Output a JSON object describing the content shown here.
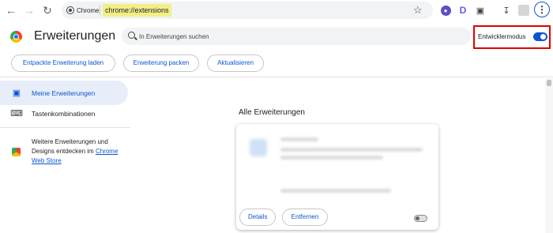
{
  "browser": {
    "back_icon": "arrow-left-icon",
    "forward_icon": "arrow-right-icon",
    "reload_icon": "reload-icon",
    "site_chip_label": "Chrome",
    "url": "chrome://extensions",
    "accent_color": "#0b57d0",
    "highlight_color": "#f2ef8a"
  },
  "header": {
    "title": "Erweiterungen",
    "search_placeholder": "In Erweiterungen suchen",
    "dev_mode_label": "Entwicklermodus",
    "dev_mode_enabled": true,
    "buttons": {
      "load_unpacked": "Entpackte Erweiterung laden",
      "pack": "Erweiterung packen",
      "update": "Aktualisieren"
    }
  },
  "sidebar": {
    "items": [
      {
        "label": "Meine Erweiterungen",
        "icon": "puzzle-icon",
        "active": true
      },
      {
        "label": "Tastenkombinationen",
        "icon": "keyboard-icon",
        "active": false
      }
    ],
    "store_text": "Weitere Erweiterungen und Designs entdecken im",
    "store_link": "Chrome Web Store"
  },
  "main": {
    "section_title": "Alle Erweiterungen",
    "card": {
      "details_label": "Details",
      "remove_label": "Entfernen",
      "enabled": false
    }
  }
}
